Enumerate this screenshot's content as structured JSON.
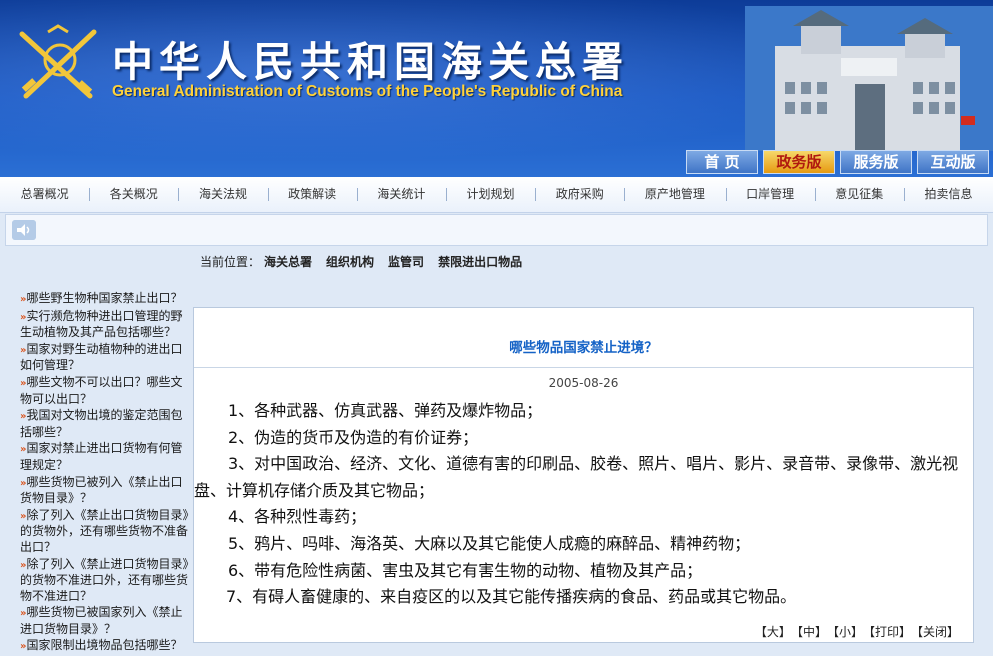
{
  "header": {
    "title_cn": "中华人民共和国海关总署",
    "title_en": "General Administration of Customs of the People's Republic of China",
    "emblem_icon": "customs-emblem-icon",
    "modes": [
      {
        "label": "首  页",
        "active": false
      },
      {
        "label": "政务版",
        "active": true
      },
      {
        "label": "服务版",
        "active": false
      },
      {
        "label": "互动版",
        "active": false
      }
    ]
  },
  "nav": [
    "总署概况",
    "各关概况",
    "海关法规",
    "政策解读",
    "海关统计",
    "计划规划",
    "政府采购",
    "原产地管理",
    "口岸管理",
    "意见征集",
    "拍卖信息"
  ],
  "audio": {
    "icon": "speaker-icon"
  },
  "breadcrumb": {
    "label": "当前位置：",
    "items": [
      "海关总署",
      "组织机构",
      "监管司",
      "禁限进出口物品"
    ]
  },
  "sidebar": {
    "items": [
      "哪些野生物种国家禁止出口？",
      "实行濒危物种进出口管理的野生动植物及其产品包括哪些？",
      "国家对野生动植物种的进出口如何管理？",
      "哪些文物不可以出口？哪些文物可以出口？",
      "我国对文物出境的鉴定范围包括哪些？",
      "国家对禁止进出口货物有何管理规定？",
      "哪些货物已被列入《禁止出口货物目录》？",
      "除了列入《禁止出口货物目录》的货物外，还有哪些货物不准备出口？",
      "除了列入《禁止进口货物目录》的货物不准进口外，还有哪些货物不准进口？",
      "哪些货物已被国家列入《禁止进口货物目录》？",
      "国家限制出境物品包括哪些？"
    ]
  },
  "article": {
    "title": "哪些物品国家禁止进境？",
    "date": "2005-08-26",
    "paragraphs": [
      "1、各种武器、仿真武器、弹药及爆炸物品；",
      "2、伪造的货币及伪造的有价证券；",
      "3、对中国政治、经济、文化、道德有害的印刷品、胶卷、照片、唱片、影片、录音带、录像带、激光视盘、计算机存储介质及其它物品；",
      "4、各种烈性毒药；",
      "5、鸦片、吗啡、海洛英、大麻以及其它能使人成瘾的麻醉品、精神药物；",
      "6、带有危险性病菌、害虫及其它有害生物的动物、植物及其产品；",
      "7、有碍人畜健康的、来自疫区的以及其它能传播疾病的食品、药品或其它物品。"
    ],
    "tools": [
      "【大】",
      "【中】",
      "【小】",
      "【打印】",
      "【关闭】"
    ]
  }
}
